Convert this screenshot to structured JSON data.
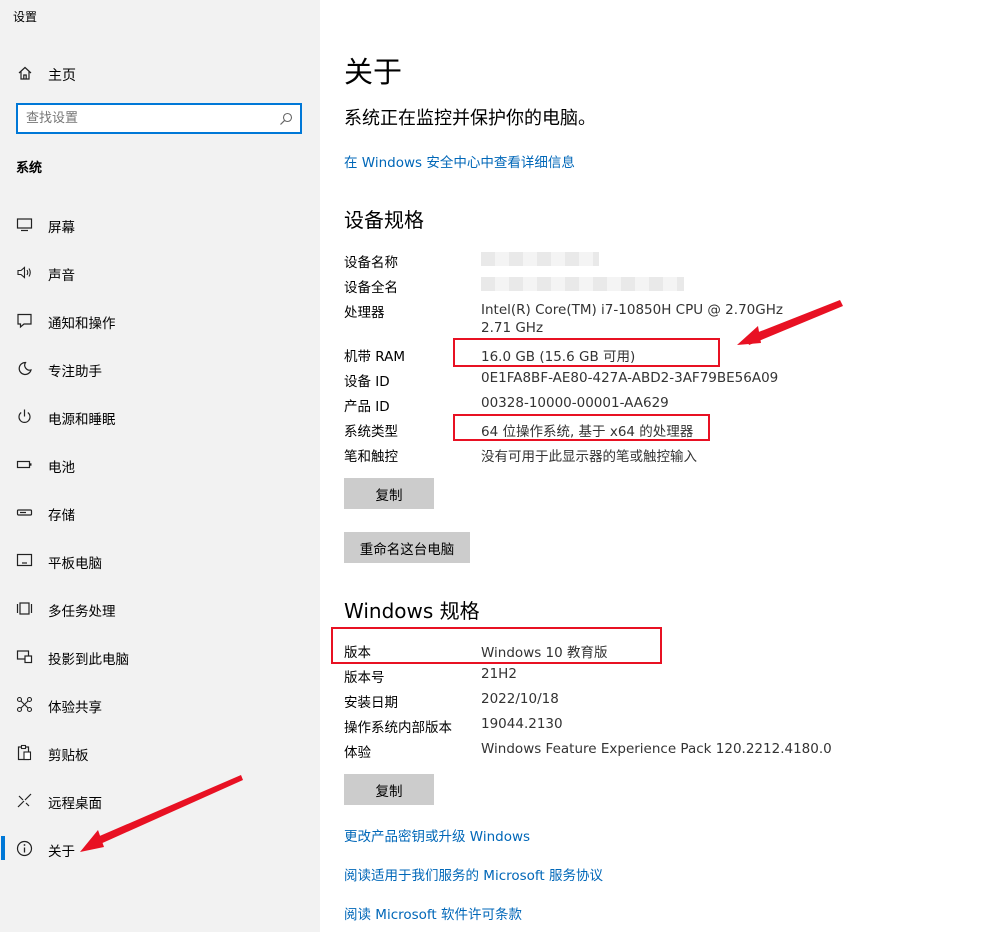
{
  "window": {
    "title": "设置"
  },
  "sidebar": {
    "home_label": "主页",
    "search": {
      "placeholder": "查找设置"
    },
    "section": "系统",
    "items": [
      {
        "label": "屏幕",
        "icon": "display-icon"
      },
      {
        "label": "声音",
        "icon": "speaker-icon"
      },
      {
        "label": "通知和操作",
        "icon": "notification-icon"
      },
      {
        "label": "专注助手",
        "icon": "moon-icon"
      },
      {
        "label": "电源和睡眠",
        "icon": "power-icon"
      },
      {
        "label": "电池",
        "icon": "battery-icon"
      },
      {
        "label": "存储",
        "icon": "storage-icon"
      },
      {
        "label": "平板电脑",
        "icon": "tablet-icon"
      },
      {
        "label": "多任务处理",
        "icon": "multitask-icon"
      },
      {
        "label": "投影到此电脑",
        "icon": "projection-icon"
      },
      {
        "label": "体验共享",
        "icon": "share-icon"
      },
      {
        "label": "剪贴板",
        "icon": "clipboard-icon"
      },
      {
        "label": "远程桌面",
        "icon": "remote-desktop-icon"
      },
      {
        "label": "关于",
        "icon": "info-icon",
        "selected": true
      }
    ]
  },
  "main": {
    "title": "关于",
    "status": "系统正在监控并保护你的电脑。",
    "security_link": "在 Windows 安全中心中查看详细信息",
    "device_specs": {
      "heading": "设备规格",
      "rows": [
        {
          "label": "设备名称",
          "value": ""
        },
        {
          "label": "设备全名",
          "value": ""
        },
        {
          "label": "处理器",
          "value": "Intel(R) Core(TM) i7-10850H CPU @ 2.70GHz   2.71 GHz"
        },
        {
          "label": "机带 RAM",
          "value": "16.0 GB (15.6 GB 可用)"
        },
        {
          "label": "设备 ID",
          "value": "0E1FA8BF-AE80-427A-ABD2-3AF79BE56A09"
        },
        {
          "label": "产品 ID",
          "value": "00328-10000-00001-AA629"
        },
        {
          "label": "系统类型",
          "value": "64 位操作系统, 基于 x64 的处理器"
        },
        {
          "label": "笔和触控",
          "value": "没有可用于此显示器的笔或触控输入"
        }
      ],
      "copy_button": "复制",
      "rename_button": "重命名这台电脑"
    },
    "windows_specs": {
      "heading": "Windows 规格",
      "rows": [
        {
          "label": "版本",
          "value": "Windows 10 教育版"
        },
        {
          "label": "版本号",
          "value": "21H2"
        },
        {
          "label": "安装日期",
          "value": "2022/10/18"
        },
        {
          "label": "操作系统内部版本",
          "value": "19044.2130"
        },
        {
          "label": "体验",
          "value": "Windows Feature Experience Pack 120.2212.4180.0"
        }
      ],
      "copy_button": "复制"
    },
    "links": [
      "更改产品密钥或升级 Windows",
      "阅读适用于我们服务的 Microsoft 服务协议",
      "阅读 Microsoft 软件许可条款"
    ]
  },
  "colors": {
    "accent": "#0078d7",
    "link": "#0067b8",
    "annotation": "#e81123",
    "sidebar_bg": "#f2f2f2",
    "button_bg": "#cccccc"
  }
}
